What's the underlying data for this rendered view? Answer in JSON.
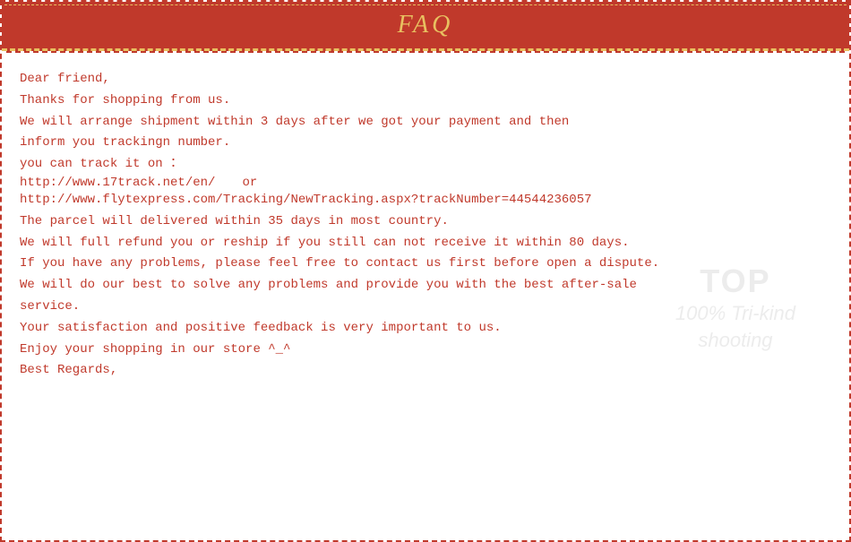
{
  "header": {
    "title": "FAQ",
    "bg_color": "#c0392b",
    "title_color": "#e8c060"
  },
  "content": {
    "line1": "Dear friend,",
    "line2": "Thanks for shopping from us.",
    "line3": "We will arrange shipment within 3 days after we got your payment and then",
    "line4": "inform you trackingn number.",
    "line5": "you can track it on ：",
    "tracking_url1": "http://www.17track.net/en/",
    "or_text": "or",
    "tracking_url2": "http://www.flytexpress.com/Tracking/NewTracking.aspx?trackNumber=44544236057",
    "line8": "The parcel will delivered within 35 days in most country.",
    "line9": "We will full refund you or reship if you still can not receive it within 80 days.",
    "line10": "If you have any problems, please feel free to contact us first before open a dispute.",
    "line11": "We will do our best to solve any problems and provide you with the best after-sale",
    "line12": "service.",
    "line13": "Your satisfaction and positive feedback is very important to us.",
    "line14": "Enjoy your shopping in our store ^_^",
    "line15": "Best Regards,"
  },
  "watermark": {
    "top": "TOP",
    "bottom_line1": "100% Tri-kind",
    "bottom_line2": "shooting"
  }
}
